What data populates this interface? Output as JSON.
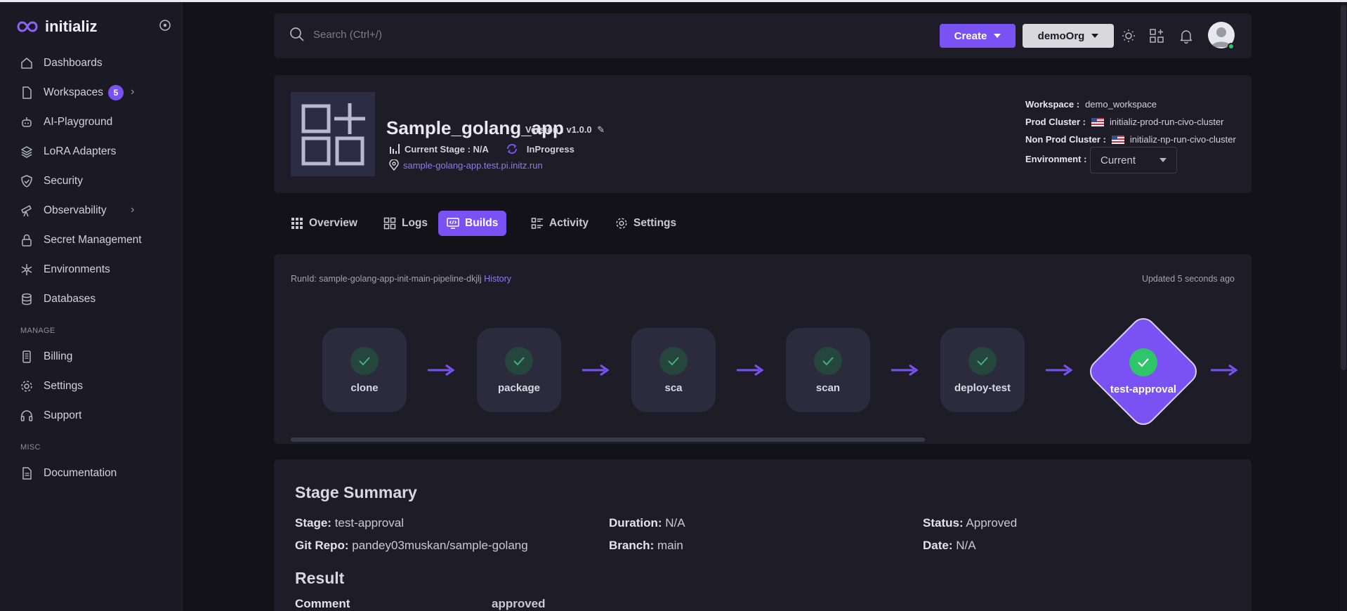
{
  "brand": {
    "name": "initializ"
  },
  "sidebar": {
    "items": [
      {
        "label": "Dashboards",
        "icon": "home-icon"
      },
      {
        "label": "Workspaces",
        "icon": "document-icon",
        "badge": "5"
      },
      {
        "label": "AI-Playground",
        "icon": "robot-icon"
      },
      {
        "label": "LoRA Adapters",
        "icon": "layers-icon"
      },
      {
        "label": "Security",
        "icon": "shield-icon"
      },
      {
        "label": "Observability",
        "icon": "telescope-icon"
      },
      {
        "label": "Secret Management",
        "icon": "lock-icon"
      },
      {
        "label": "Environments",
        "icon": "snowflake-icon"
      },
      {
        "label": "Databases",
        "icon": "database-icon"
      }
    ],
    "manage_label": "MANAGE",
    "manage_items": [
      {
        "label": "Billing",
        "icon": "receipt-icon"
      },
      {
        "label": "Settings",
        "icon": "gear-icon"
      },
      {
        "label": "Support",
        "icon": "headset-icon"
      }
    ],
    "misc_label": "MISC",
    "misc_items": [
      {
        "label": "Documentation",
        "icon": "document-icon"
      }
    ]
  },
  "header": {
    "search_placeholder": "Search (Ctrl+/)",
    "create_label": "Create",
    "org_label": "demoOrg"
  },
  "app": {
    "title": "Sample_golang_app",
    "version": "Version : v1.0.0",
    "current_stage": "Current Stage : N/A",
    "status": "InProgress",
    "url": "sample-golang-app.test.pi.initz.run",
    "workspace_label": "Workspace :",
    "workspace_value": "demo_workspace",
    "prod_label": "Prod Cluster :",
    "prod_value": "initializ-prod-run-civo-cluster",
    "nonprod_label": "Non Prod Cluster :",
    "nonprod_value": "initializ-np-run-civo-cluster",
    "env_label": "Environment :",
    "env_value": "Current"
  },
  "tabs": [
    {
      "label": "Overview",
      "active": false
    },
    {
      "label": "Logs",
      "active": false
    },
    {
      "label": "Builds",
      "active": true
    },
    {
      "label": "Activity",
      "active": false
    },
    {
      "label": "Settings",
      "active": false
    }
  ],
  "pipeline": {
    "runid": "RunId: sample-golang-app-init-main-pipeline-dkjlj",
    "history": "History",
    "updated": "Updated 5 seconds ago",
    "stages": [
      "clone",
      "package",
      "sca",
      "scan",
      "deploy-test"
    ],
    "current_stage": "test-approval"
  },
  "summary": {
    "title": "Stage Summary",
    "stage_k": "Stage:",
    "stage_v": "test-approval",
    "duration_k": "Duration:",
    "duration_v": "N/A",
    "status_k": "Status:",
    "status_v": "Approved",
    "repo_k": "Git Repo:",
    "repo_v": "pandey03muskan/sample-golang",
    "branch_k": "Branch:",
    "branch_v": "main",
    "date_k": "Date:",
    "date_v": "N/A",
    "result_title": "Result",
    "comment_k": "Comment",
    "comment_v": "approved"
  },
  "colors": {
    "accent": "#7a52f4",
    "success": "#2fc66a"
  }
}
